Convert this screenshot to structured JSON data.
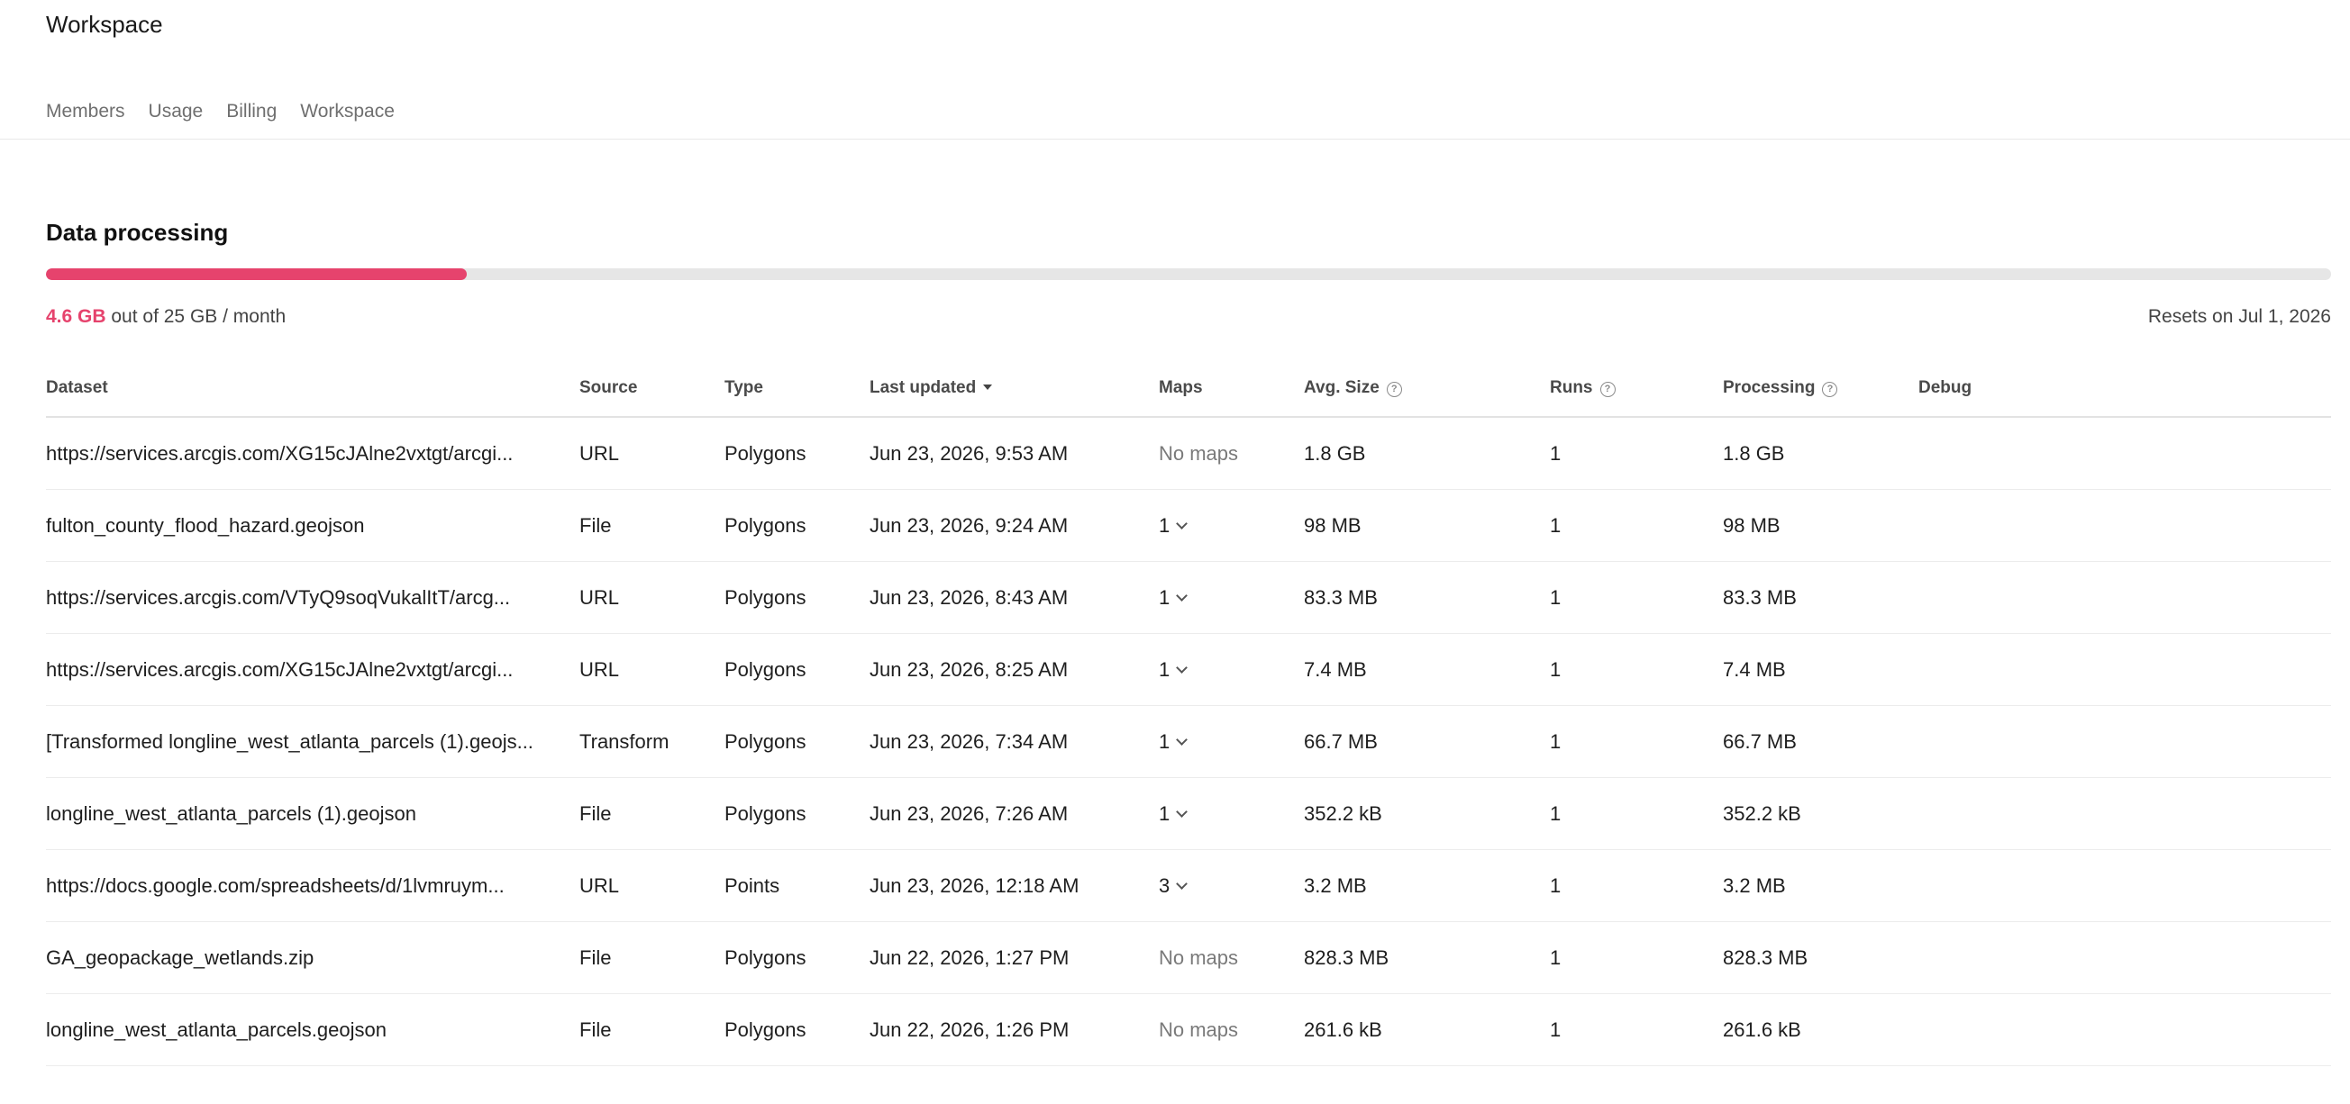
{
  "header": {
    "title": "Workspace"
  },
  "tabs": [
    {
      "label": "Members"
    },
    {
      "label": "Usage"
    },
    {
      "label": "Billing"
    },
    {
      "label": "Workspace"
    }
  ],
  "section": {
    "title": "Data processing",
    "used": "4.6 GB",
    "limit_text": "out of 25 GB / month",
    "progress_fraction": 0.184,
    "resets": "Resets on Jul 1, 2026",
    "accent_color": "#e6436d"
  },
  "table": {
    "columns": {
      "dataset": "Dataset",
      "source": "Source",
      "type": "Type",
      "last_updated": "Last updated",
      "maps": "Maps",
      "avg_size": "Avg. Size",
      "runs": "Runs",
      "processing": "Processing",
      "debug": "Debug"
    },
    "rows": [
      {
        "dataset": "https://services.arcgis.com/XG15cJAlne2vxtgt/arcgi...",
        "source": "URL",
        "type": "Polygons",
        "last_updated": "Jun 23, 2026, 9:53 AM",
        "maps": "No maps",
        "avg_size": "1.8 GB",
        "runs": "1",
        "processing": "1.8 GB"
      },
      {
        "dataset": "fulton_county_flood_hazard.geojson",
        "source": "File",
        "type": "Polygons",
        "last_updated": "Jun 23, 2026, 9:24 AM",
        "maps": "1",
        "avg_size": "98 MB",
        "runs": "1",
        "processing": "98 MB"
      },
      {
        "dataset": "https://services.arcgis.com/VTyQ9soqVukalItT/arcg...",
        "source": "URL",
        "type": "Polygons",
        "last_updated": "Jun 23, 2026, 8:43 AM",
        "maps": "1",
        "avg_size": "83.3 MB",
        "runs": "1",
        "processing": "83.3 MB"
      },
      {
        "dataset": "https://services.arcgis.com/XG15cJAlne2vxtgt/arcgi...",
        "source": "URL",
        "type": "Polygons",
        "last_updated": "Jun 23, 2026, 8:25 AM",
        "maps": "1",
        "avg_size": "7.4 MB",
        "runs": "1",
        "processing": "7.4 MB"
      },
      {
        "dataset": "[Transformed longline_west_atlanta_parcels (1).geojs...",
        "source": "Transform",
        "type": "Polygons",
        "last_updated": "Jun 23, 2026, 7:34 AM",
        "maps": "1",
        "avg_size": "66.7 MB",
        "runs": "1",
        "processing": "66.7 MB"
      },
      {
        "dataset": "longline_west_atlanta_parcels (1).geojson",
        "source": "File",
        "type": "Polygons",
        "last_updated": "Jun 23, 2026, 7:26 AM",
        "maps": "1",
        "avg_size": "352.2 kB",
        "runs": "1",
        "processing": "352.2 kB"
      },
      {
        "dataset": "https://docs.google.com/spreadsheets/d/1lvmruym...",
        "source": "URL",
        "type": "Points",
        "last_updated": "Jun 23, 2026, 12:18 AM",
        "maps": "3",
        "avg_size": "3.2 MB",
        "runs": "1",
        "processing": "3.2 MB"
      },
      {
        "dataset": "GA_geopackage_wetlands.zip",
        "source": "File",
        "type": "Polygons",
        "last_updated": "Jun 22, 2026, 1:27 PM",
        "maps": "No maps",
        "avg_size": "828.3 MB",
        "runs": "1",
        "processing": "828.3 MB"
      },
      {
        "dataset": "longline_west_atlanta_parcels.geojson",
        "source": "File",
        "type": "Polygons",
        "last_updated": "Jun 22, 2026, 1:26 PM",
        "maps": "No maps",
        "avg_size": "261.6 kB",
        "runs": "1",
        "processing": "261.6 kB"
      }
    ]
  }
}
